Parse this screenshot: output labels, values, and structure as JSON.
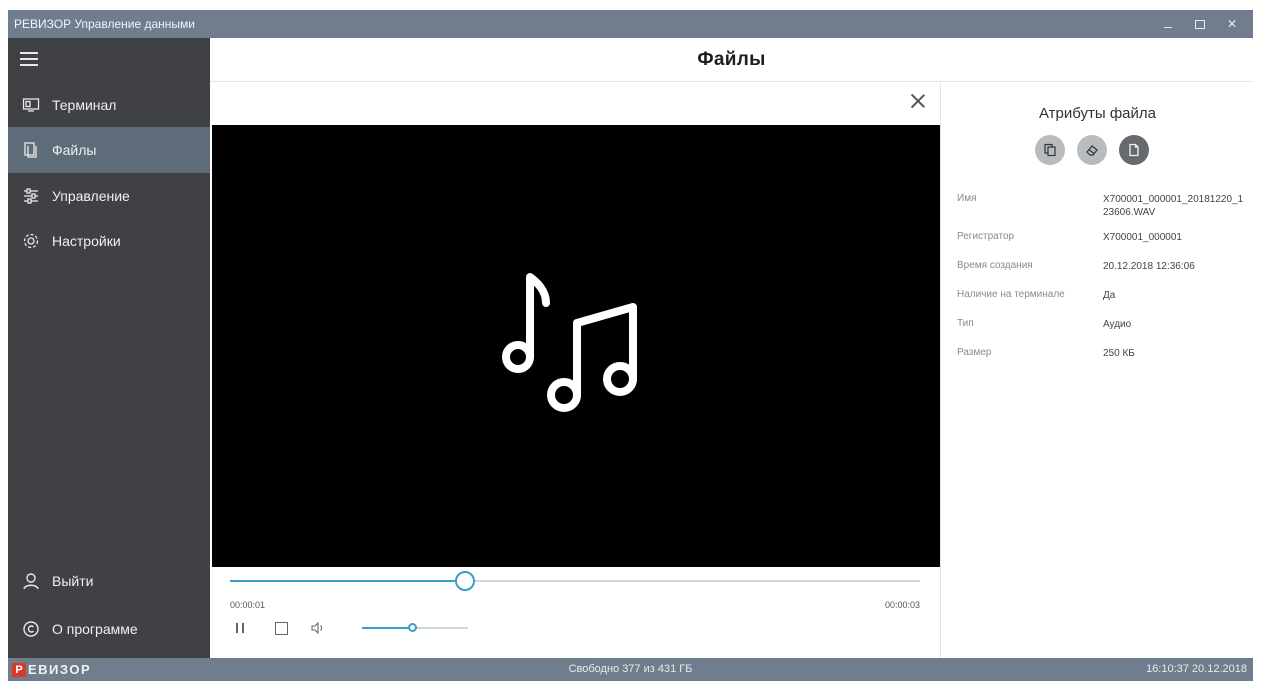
{
  "window": {
    "title": "РЕВИЗОР Управление данными"
  },
  "sidebar": {
    "items": [
      {
        "label": "Терминал",
        "icon": "terminal-icon",
        "active": false
      },
      {
        "label": "Файлы",
        "icon": "files-icon",
        "active": true
      },
      {
        "label": "Управление",
        "icon": "sliders-icon",
        "active": false
      },
      {
        "label": "Настройки",
        "icon": "gear-icon",
        "active": false
      }
    ],
    "bottom": [
      {
        "label": "Выйти",
        "icon": "user-icon"
      },
      {
        "label": "О программе",
        "icon": "copyright-icon"
      }
    ]
  },
  "header": {
    "title": "Файлы"
  },
  "player": {
    "current_time": "00:00:01",
    "total_time": "00:00:03",
    "progress": 0.34,
    "volume": 0.48
  },
  "attributes": {
    "title": "Атрибуты файла",
    "rows": [
      {
        "key": "Имя",
        "value": "X700001_000001_20181220_123606.WAV"
      },
      {
        "key": "Регистратор",
        "value": "X700001_000001"
      },
      {
        "key": "Время создания",
        "value": "20.12.2018 12:36:06"
      },
      {
        "key": "Наличие на терминале",
        "value": "Да"
      },
      {
        "key": "Тип",
        "value": "Аудио"
      },
      {
        "key": "Размер",
        "value": "250 КБ"
      }
    ]
  },
  "status": {
    "logo_letter": "Р",
    "logo_text": "ЕВИЗОР",
    "free_space": "Свободно 377 из 431 ГБ",
    "datetime": "16:10:37 20.12.2018"
  },
  "colors": {
    "accent": "#3b9dc9",
    "sidebar": "#3f4145",
    "sidebar_active": "#5e6b78",
    "titlebar": "#6f7d8c",
    "logo_red": "#d83a2a"
  }
}
